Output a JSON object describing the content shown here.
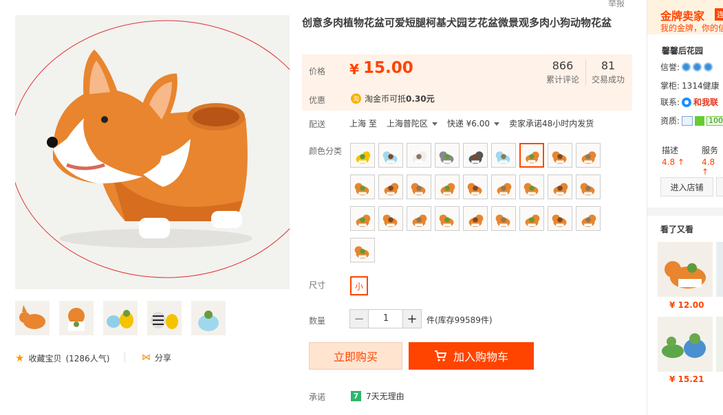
{
  "product": {
    "title": "创意多肉植物花盆可爱短腿柯基犬园艺花盆微景观多肉小狗动物花盆",
    "report_label": "举报",
    "price_label": "价格",
    "currency": "¥",
    "price": "15.00",
    "reviews_count": "866",
    "reviews_label": "累计评论",
    "deals_count": "81",
    "deals_label": "交易成功",
    "promo_label": "优惠",
    "promo_icon": "淘",
    "promo_text": "淘金币可抵",
    "promo_amount": "0.30元",
    "delivery_label": "配送",
    "delivery_from": "上海 至",
    "delivery_to": "上海普陀区",
    "delivery_fee": "快递 ¥6.00",
    "delivery_promise": "卖家承诺48小时内发货",
    "color_label": "颜色分类",
    "color_swatch_count": 28,
    "color_selected_index": 6,
    "size_label": "尺寸",
    "size_option": "小",
    "qty_label": "数量",
    "qty_value": "1",
    "qty_minus": "−",
    "qty_plus": "+",
    "stock_text": "件(库存99589件)",
    "buy_now": "立即购买",
    "add_to_cart": "加入购物车",
    "promise_label": "承诺",
    "promise_icon": "7",
    "promise_text": "7天无理由"
  },
  "gallery": {
    "favorite_label": "收藏宝贝",
    "favorite_count": "(1286人气)",
    "share_label": "分享"
  },
  "seller": {
    "gold_title": "金牌卖家",
    "gold_badge": "连",
    "gold_sub": "我的金牌，你的信",
    "shop_name": "馨馨后花园",
    "reputation_label": "信誉:",
    "seller_label": "掌柜:",
    "seller_value": "1314健康",
    "contact_label": "联系:",
    "contact_value": "和我联",
    "qual_label": "资质:",
    "qual_value": "100",
    "desc_label": "描述",
    "desc_score": "4.8",
    "service_label": "服务",
    "service_score": "4.8",
    "enter_store": "进入店铺"
  },
  "recommend": {
    "title": "看了又看",
    "items": [
      {
        "price": "¥ 12.00"
      },
      {
        "price": "¥ 15.21"
      }
    ]
  },
  "colors": {
    "accent": "#ff4400",
    "price_bg": "#fff2e8"
  }
}
